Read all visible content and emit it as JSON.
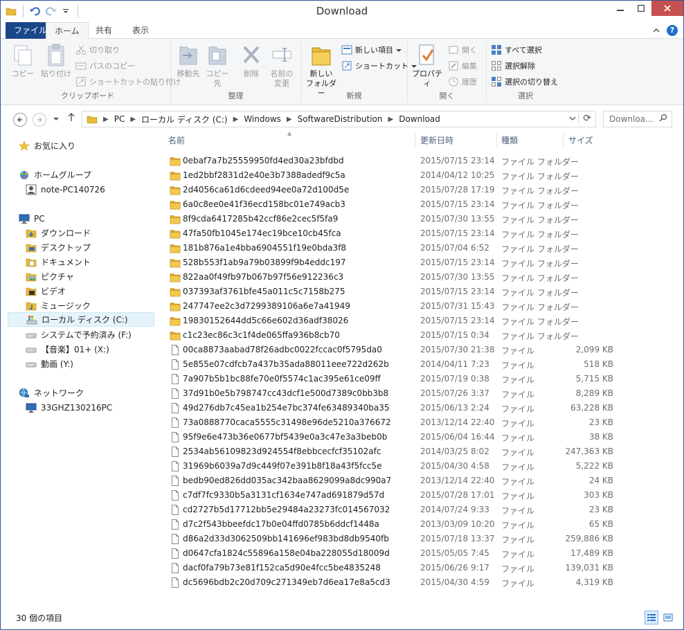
{
  "window": {
    "title": "Download"
  },
  "tabs": {
    "file": "ファイル",
    "home": "ホーム",
    "share": "共有",
    "view": "表示"
  },
  "ribbon": {
    "clipboard": {
      "label": "クリップボード",
      "copy": "コピー",
      "paste": "貼り付け",
      "cut": "切り取り",
      "copy_path": "パスのコピー",
      "paste_shortcut": "ショートカットの貼り付け"
    },
    "organize": {
      "label": "整理",
      "move_to": "移動先",
      "copy_to": "コピー先",
      "delete": "削除",
      "rename_l1": "名前の",
      "rename_l2": "変更"
    },
    "new": {
      "label": "新規",
      "new_folder_l1": "新しい",
      "new_folder_l2": "フォルダー",
      "new_item": "新しい項目",
      "shortcut": "ショートカット"
    },
    "open": {
      "label": "開く",
      "properties": "プロパティ",
      "open": "開く",
      "edit": "編集",
      "history": "履歴"
    },
    "select": {
      "label": "選択",
      "select_all": "すべて選択",
      "select_none": "選択解除",
      "invert": "選択の切り替え"
    }
  },
  "address": {
    "crumbs": [
      "PC",
      "ローカル ディスク (C:)",
      "Windows",
      "SoftwareDistribution",
      "Download"
    ],
    "search_placeholder": "Downloa..."
  },
  "navpane": {
    "favorites": "お気に入り",
    "homegroup": "ホームグループ",
    "homegroup_user": "note-PC140726",
    "pc": "PC",
    "downloads": "ダウンロード",
    "desktop": "デスクトップ",
    "documents": "ドキュメント",
    "pictures": "ピクチャ",
    "videos": "ビデオ",
    "music": "ミュージック",
    "local_disk": "ローカル ディスク (C:)",
    "system_reserved": "システムで予約済み (F:)",
    "music_drive": "【音楽】01+ (X:)",
    "video_drive": "動画 (Y:)",
    "network": "ネットワーク",
    "network_pc": "33GHZ130216PC"
  },
  "columns": {
    "name": "名前",
    "date": "更新日時",
    "type": "種類",
    "size": "サイズ"
  },
  "files": [
    {
      "kind": "folder",
      "name": "0ebaf7a7b25559950fd4ed30a23bfdbd",
      "date": "2015/07/15 23:14",
      "type": "ファイル フォルダー",
      "size": ""
    },
    {
      "kind": "folder",
      "name": "1ed2bbf2831d2e40e3b7388adedf9c5a",
      "date": "2014/04/12 10:25",
      "type": "ファイル フォルダー",
      "size": ""
    },
    {
      "kind": "folder",
      "name": "2d4056ca61d6cdeed94ee0a72d100d5e",
      "date": "2015/07/28 17:19",
      "type": "ファイル フォルダー",
      "size": ""
    },
    {
      "kind": "folder",
      "name": "6a0c8ee0e41f36ecd158bc01e749acb3",
      "date": "2015/07/15 23:14",
      "type": "ファイル フォルダー",
      "size": ""
    },
    {
      "kind": "folder",
      "name": "8f9cda6417285b42ccf86e2cec5f5fa9",
      "date": "2015/07/30 13:55",
      "type": "ファイル フォルダー",
      "size": ""
    },
    {
      "kind": "folder",
      "name": "47fa50fb1045e174ec19bce10cb45fca",
      "date": "2015/07/15 23:14",
      "type": "ファイル フォルダー",
      "size": ""
    },
    {
      "kind": "folder",
      "name": "181b876a1e4bba6904551f19e0bda3f8",
      "date": "2015/07/04 6:52",
      "type": "ファイル フォルダー",
      "size": ""
    },
    {
      "kind": "folder",
      "name": "528b553f1ab9a79b03899f9b4eddc197",
      "date": "2015/07/15 23:14",
      "type": "ファイル フォルダー",
      "size": ""
    },
    {
      "kind": "folder",
      "name": "822aa0f49fb97b067b97f56e912236c3",
      "date": "2015/07/30 13:55",
      "type": "ファイル フォルダー",
      "size": ""
    },
    {
      "kind": "folder",
      "name": "037393af3761bfe45a011c5c7158b275",
      "date": "2015/07/15 23:14",
      "type": "ファイル フォルダー",
      "size": ""
    },
    {
      "kind": "folder",
      "name": "247747ee2c3d7299389106a6e7a41949",
      "date": "2015/07/31 15:43",
      "type": "ファイル フォルダー",
      "size": ""
    },
    {
      "kind": "folder",
      "name": "19830152644dd5c66e602d36adf38026",
      "date": "2015/07/15 23:14",
      "type": "ファイル フォルダー",
      "size": ""
    },
    {
      "kind": "folder",
      "name": "c1c23ec86c3c1f4de065ffa936b8cb70",
      "date": "2015/07/15 0:34",
      "type": "ファイル フォルダー",
      "size": ""
    },
    {
      "kind": "file",
      "name": "00ca8873aabad78f26adbc0022fccac0f5795da0",
      "date": "2015/07/30 21:38",
      "type": "ファイル",
      "size": "2,099 KB"
    },
    {
      "kind": "file",
      "name": "5e855e07cdfcb7a437b35ada88011eee722d262b",
      "date": "2014/04/11 7:23",
      "type": "ファイル",
      "size": "518 KB"
    },
    {
      "kind": "file",
      "name": "7a907b5b1bc88fe70e0f5574c1ac395e61ce09ff",
      "date": "2015/07/19 0:38",
      "type": "ファイル",
      "size": "5,715 KB"
    },
    {
      "kind": "file",
      "name": "37d91b0e5b798747cc43dcf1e500d7389c0bb3b8",
      "date": "2015/07/26 3:37",
      "type": "ファイル",
      "size": "8,289 KB"
    },
    {
      "kind": "file",
      "name": "49d276db7c45ea1b254e7bc374fe63489340ba35",
      "date": "2015/06/13 2:24",
      "type": "ファイル",
      "size": "63,228 KB"
    },
    {
      "kind": "file",
      "name": "73a0888770caca5555c31498e96de5210a376672",
      "date": "2013/12/14 22:40",
      "type": "ファイル",
      "size": "23 KB"
    },
    {
      "kind": "file",
      "name": "95f9e6e473b36e0677bf5439e0a3c47e3a3beb0b",
      "date": "2015/06/04 16:44",
      "type": "ファイル",
      "size": "38 KB"
    },
    {
      "kind": "file",
      "name": "2534ab56109823d924554f8ebbcecfcf35102afc",
      "date": "2014/03/25 8:02",
      "type": "ファイル",
      "size": "247,363 KB"
    },
    {
      "kind": "file",
      "name": "31969b6039a7d9c449f07e391b8f18a43f5fcc5e",
      "date": "2015/04/30 4:58",
      "type": "ファイル",
      "size": "5,222 KB"
    },
    {
      "kind": "file",
      "name": "bedb90ed826dd035ac342baa8629099a8dc990a7",
      "date": "2013/12/14 22:40",
      "type": "ファイル",
      "size": "24 KB"
    },
    {
      "kind": "file",
      "name": "c7df7fc9330b5a3131cf1634e747ad691879d57d",
      "date": "2015/07/28 17:01",
      "type": "ファイル",
      "size": "303 KB"
    },
    {
      "kind": "file",
      "name": "cd2727b5d17712bb5e29484a23273fc014567032",
      "date": "2014/07/24 9:33",
      "type": "ファイル",
      "size": "23 KB"
    },
    {
      "kind": "file",
      "name": "d7c2f543bbeefdc17b0e04ffd0785b6ddcf1448a",
      "date": "2013/03/09 10:20",
      "type": "ファイル",
      "size": "65 KB"
    },
    {
      "kind": "file",
      "name": "d86a2d33d3062509bb141696ef983bd8db9540fb",
      "date": "2015/07/18 13:37",
      "type": "ファイル",
      "size": "259,886 KB"
    },
    {
      "kind": "file",
      "name": "d0647cfa1824c55896a158e04ba228055d18009d",
      "date": "2015/05/05 7:45",
      "type": "ファイル",
      "size": "17,489 KB"
    },
    {
      "kind": "file",
      "name": "dacf0fa79b73e81f152ca5d90e4fcc5be4835248",
      "date": "2015/06/26 9:17",
      "type": "ファイル",
      "size": "139,031 KB"
    },
    {
      "kind": "file",
      "name": "dc5696bdb2c20d709c271349eb7d6ea17e8a5cd3",
      "date": "2015/04/30 4:59",
      "type": "ファイル",
      "size": "4,319 KB"
    }
  ],
  "status": {
    "count": "30 個の項目"
  },
  "colors": {
    "accent": "#19478a",
    "close": "#c75050",
    "folder": "#e8b93a"
  }
}
